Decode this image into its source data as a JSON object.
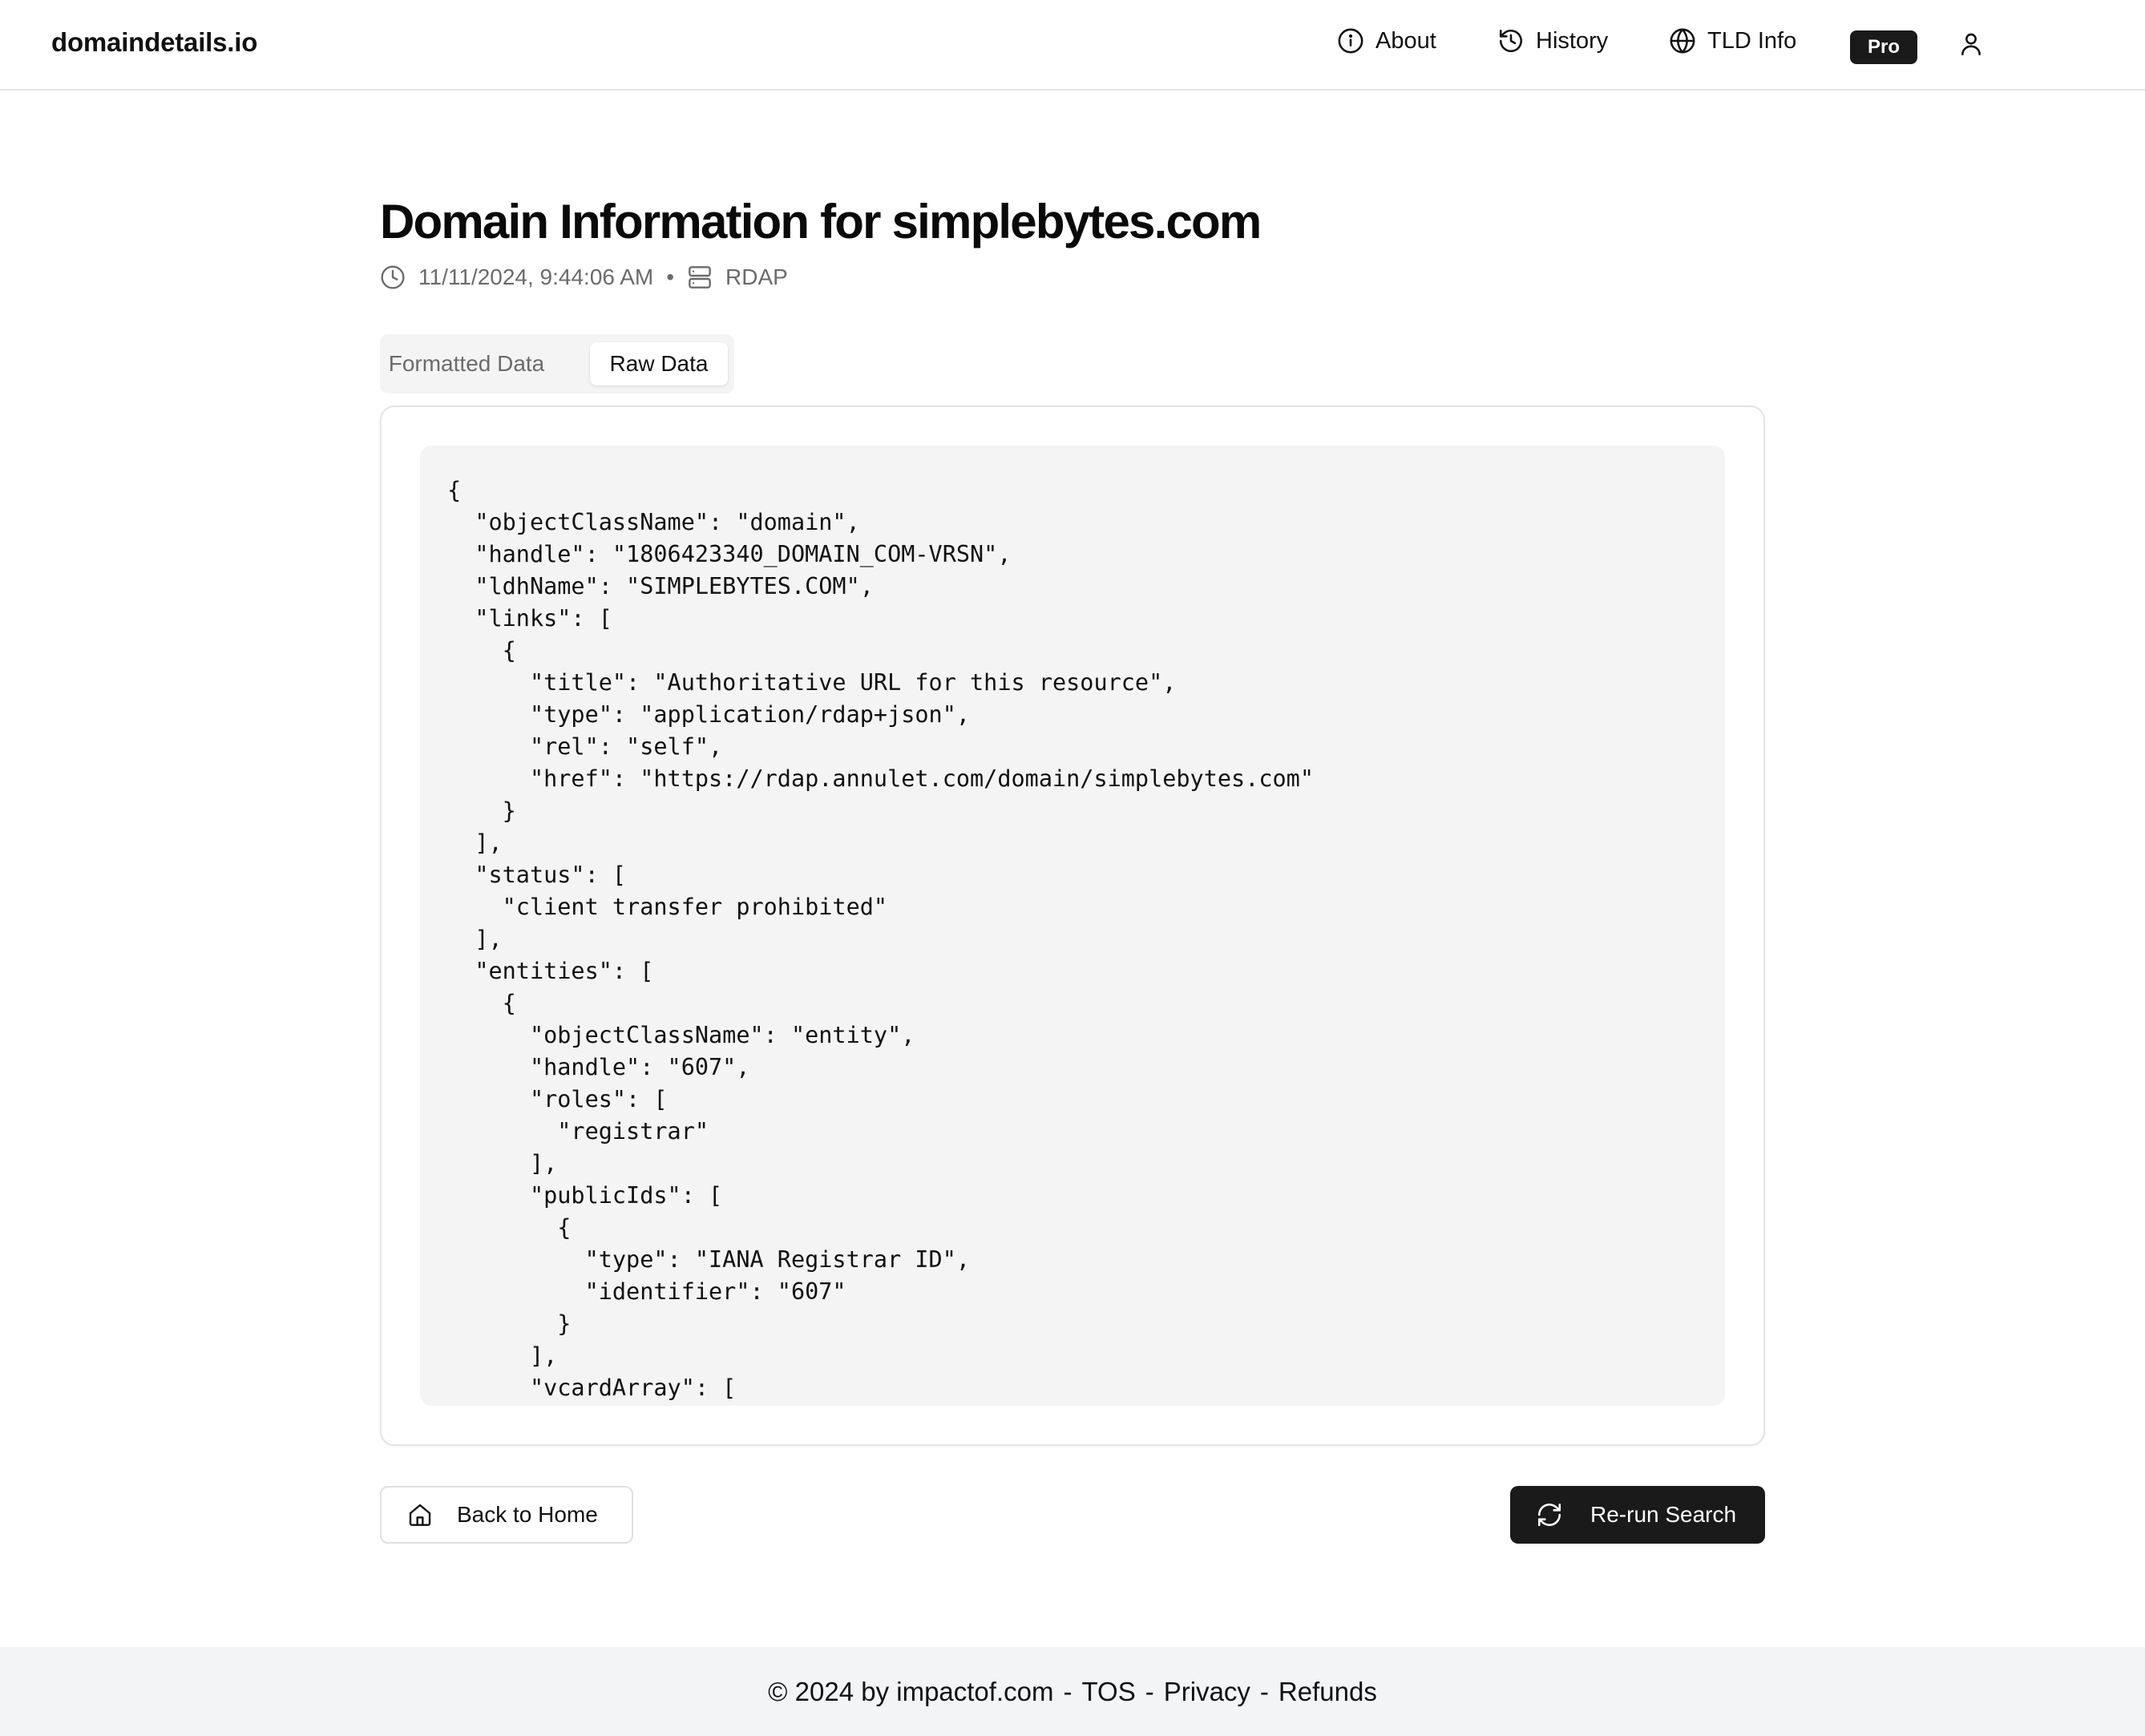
{
  "header": {
    "brand": "domaindetails.io",
    "nav": {
      "about": "About",
      "history": "History",
      "tld_info": "TLD Info",
      "pro": "Pro"
    }
  },
  "main": {
    "title": "Domain Information for simplebytes.com",
    "timestamp": "11/11/2024, 9:44:06 AM",
    "separator": "•",
    "source": "RDAP",
    "tabs": [
      {
        "label": "Formatted Data",
        "active": false
      },
      {
        "label": "Raw Data",
        "active": true
      }
    ],
    "raw_json": "{\n  \"objectClassName\": \"domain\",\n  \"handle\": \"1806423340_DOMAIN_COM-VRSN\",\n  \"ldhName\": \"SIMPLEBYTES.COM\",\n  \"links\": [\n    {\n      \"title\": \"Authoritative URL for this resource\",\n      \"type\": \"application/rdap+json\",\n      \"rel\": \"self\",\n      \"href\": \"https://rdap.annulet.com/domain/simplebytes.com\"\n    }\n  ],\n  \"status\": [\n    \"client transfer prohibited\"\n  ],\n  \"entities\": [\n    {\n      \"objectClassName\": \"entity\",\n      \"handle\": \"607\",\n      \"roles\": [\n        \"registrar\"\n      ],\n      \"publicIds\": [\n        {\n          \"type\": \"IANA Registrar ID\",\n          \"identifier\": \"607\"\n        }\n      ],\n      \"vcardArray\": [\n        \"vcard\","
  },
  "actions": {
    "back_home": "Back to Home",
    "rerun": "Re-run Search"
  },
  "footer": {
    "copyright": "© 2024 by impactof.com",
    "sep": "-",
    "tos": "TOS",
    "privacy": "Privacy",
    "refunds": "Refunds"
  },
  "colors": {
    "primary_dark": "#1a1a1a",
    "muted_text": "#6b6b6b",
    "code_bg": "#f4f4f4",
    "footer_bg": "#f3f4f6",
    "border": "#e5e5e5"
  },
  "icons": {
    "about": "info-icon",
    "history": "history-icon",
    "tld_info": "globe-icon",
    "user": "user-icon",
    "timestamp": "clock-icon",
    "source": "server-icon",
    "back_home": "home-icon",
    "rerun": "refresh-icon"
  }
}
